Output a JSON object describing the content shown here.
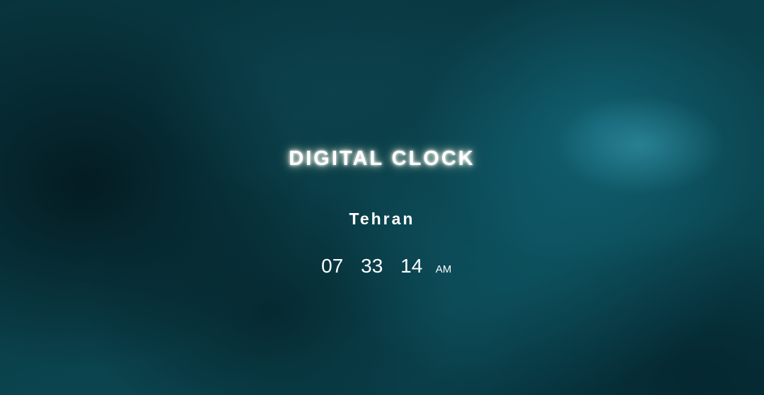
{
  "app": {
    "title": "DIGITAL CLOCK"
  },
  "clock": {
    "city": "Tehran",
    "hours": "07",
    "minutes": "33",
    "seconds": "14",
    "period": "AM"
  },
  "colors": {
    "text": "#ffffff",
    "background": "#0a3f49"
  }
}
